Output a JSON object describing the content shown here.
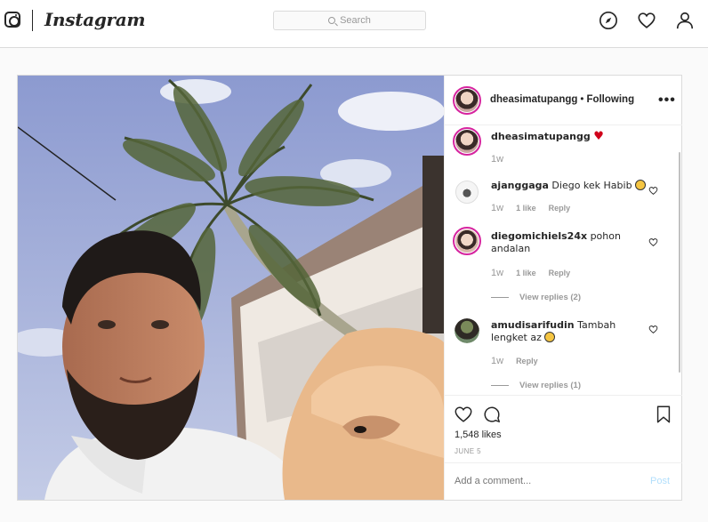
{
  "header": {
    "logo_text": "Instagram",
    "search_placeholder": "Search"
  },
  "post": {
    "author": "dheasimatupangg",
    "follow_status": "Following",
    "separator": "•",
    "caption": {
      "username": "dheasimatupangg",
      "time": "1w"
    },
    "comments": [
      {
        "username": "ajanggaga",
        "text": "Diego kek Habib",
        "time": "1w",
        "likes": "1 like",
        "reply": "Reply"
      },
      {
        "username": "diegomichiels24x",
        "text": "pohon andalan",
        "time": "1w",
        "likes": "1 like",
        "reply": "Reply",
        "view_replies": "View replies (2)"
      },
      {
        "username": "amudisarifudin",
        "text": "Tambah lengket az",
        "time": "1w",
        "reply": "Reply",
        "view_replies": "View replies (1)"
      }
    ],
    "likes_count": "1,548 likes",
    "date": "JUNE 5",
    "add_comment_placeholder": "Add a comment...",
    "post_button": "Post"
  },
  "colors": {
    "avatar_ring": "#d6249f",
    "post_button": "#b2dffc",
    "border": "#dbdbdb"
  },
  "icons": {
    "nav": [
      "explore-compass-icon",
      "activity-heart-icon",
      "profile-icon"
    ],
    "actions": [
      "like-heart-icon",
      "comment-bubble-icon",
      "save-bookmark-icon"
    ]
  }
}
